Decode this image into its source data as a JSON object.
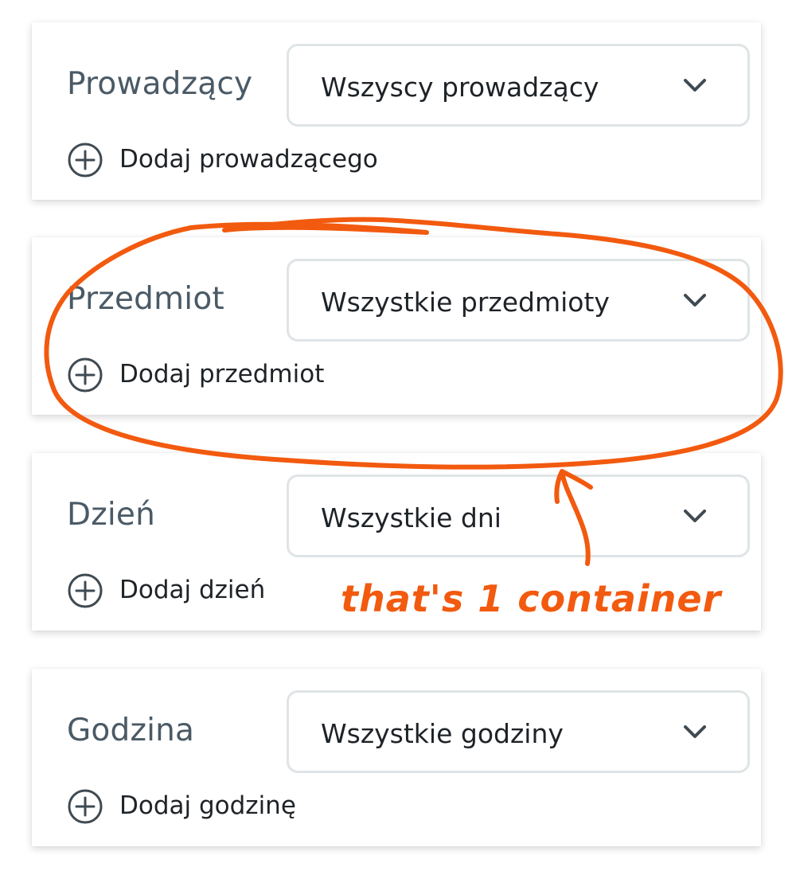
{
  "filters": [
    {
      "label": "Prowadzący",
      "value": "Wszyscy prowadzący",
      "add": "Dodaj prowadzącego"
    },
    {
      "label": "Przedmiot",
      "value": "Wszystkie przedmioty",
      "add": "Dodaj przedmiot"
    },
    {
      "label": "Dzień",
      "value": "Wszystkie dni",
      "add": "Dodaj dzień"
    },
    {
      "label": "Godzina",
      "value": "Wszystkie godziny",
      "add": "Dodaj godzinę"
    }
  ],
  "annotation": {
    "note": "that's 1 container",
    "color": "#f25a0f"
  },
  "colors": {
    "label": "#4a5a66",
    "text": "#1e2328",
    "border": "#dfe4e6",
    "icon": "#3f4a52"
  },
  "icons": {
    "dropdown": "chevron-down-icon",
    "add": "plus-circle-icon"
  }
}
